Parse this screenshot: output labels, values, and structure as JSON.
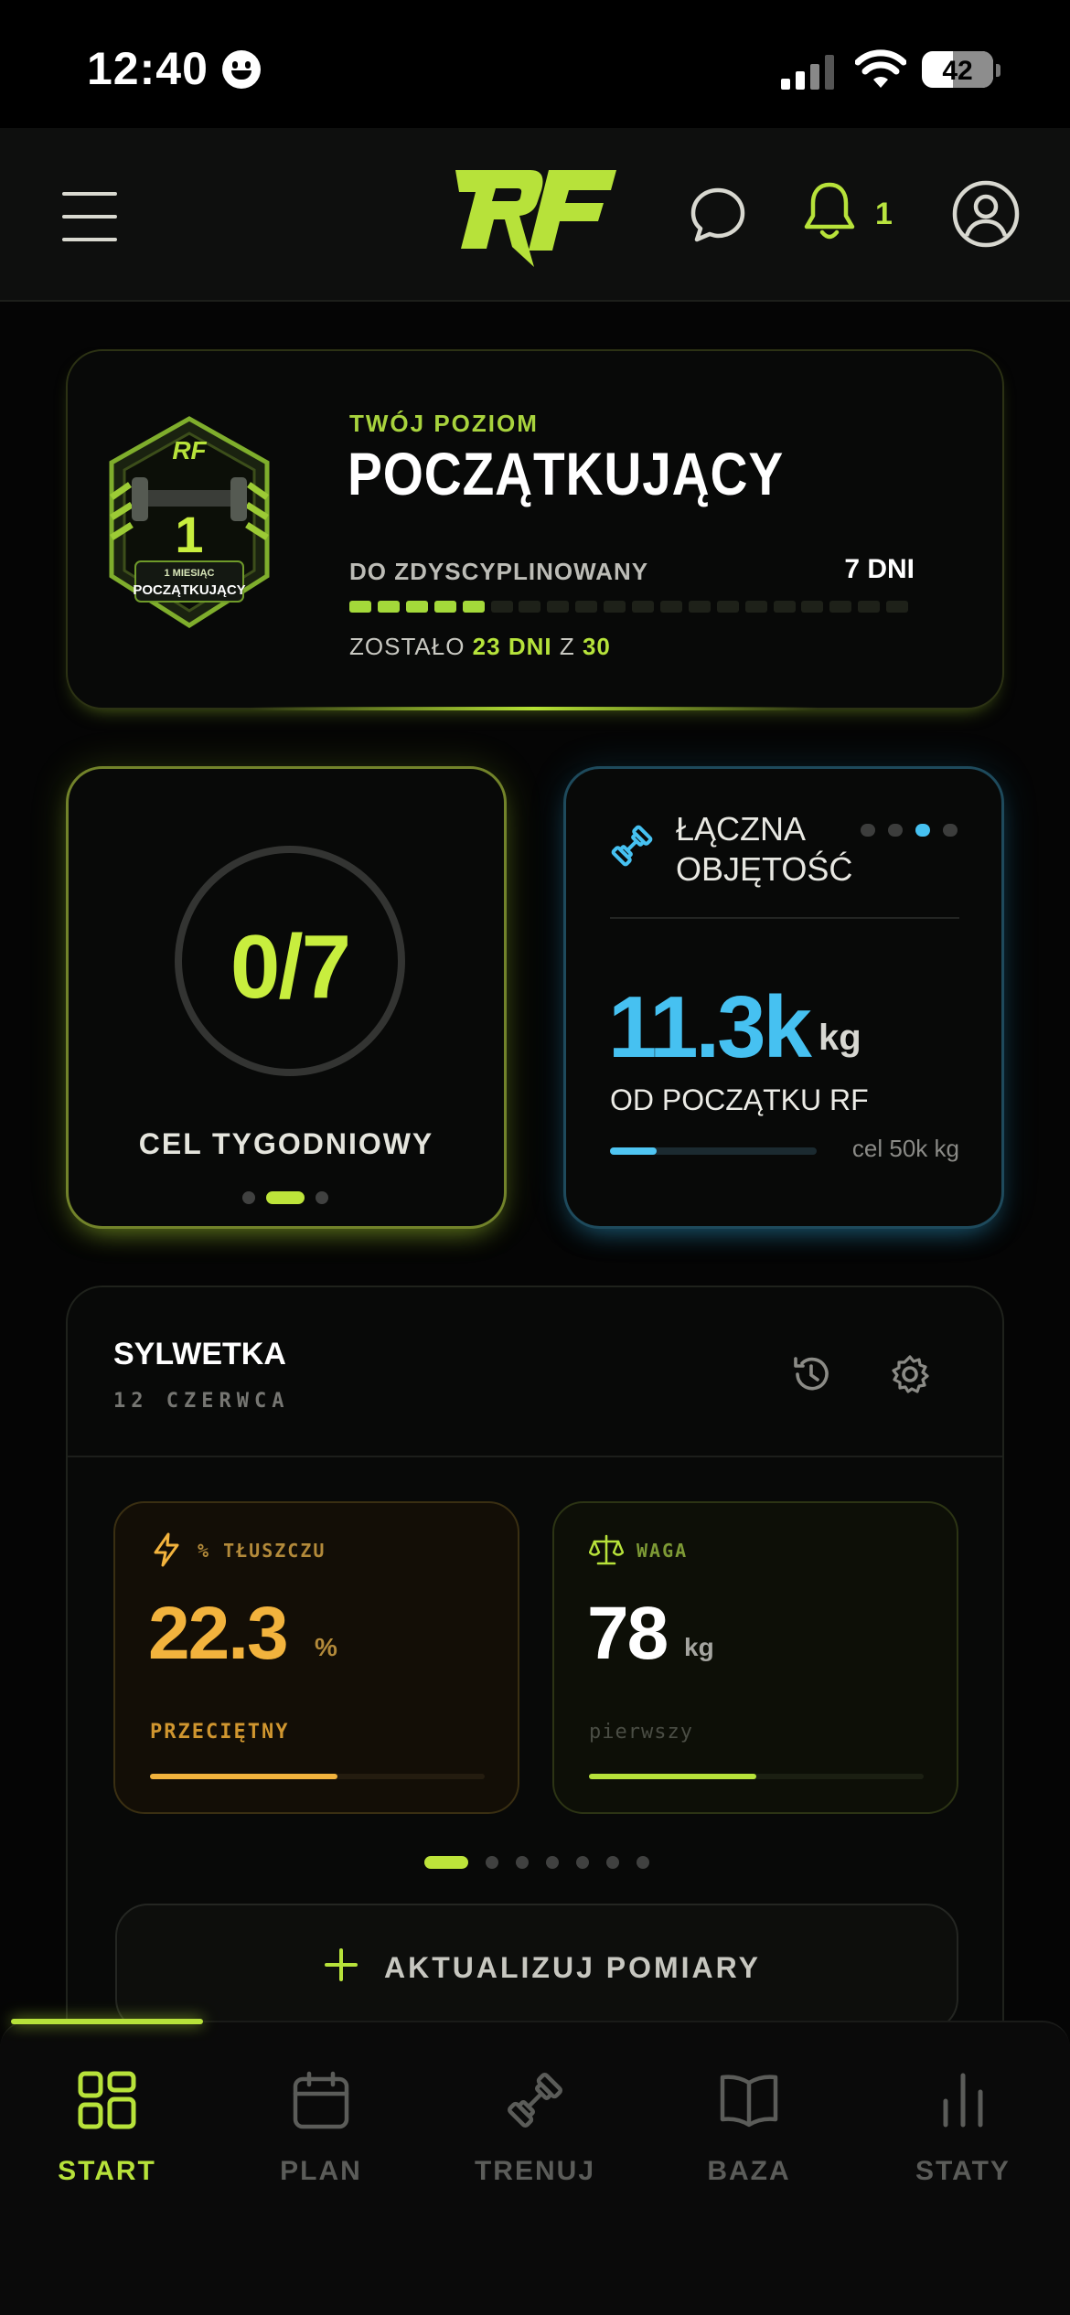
{
  "status_bar": {
    "time": "12:40",
    "battery": "42"
  },
  "header": {
    "logo": "RF",
    "notification_count": "1"
  },
  "level": {
    "eyebrow": "TWÓJ POZIOM",
    "title": "POCZĄTKUJĄCY",
    "next_label": "DO ZDYSCYPLINOWANY",
    "days_to_next": "7 DNI",
    "progress": {
      "filled": 5,
      "total": 20
    },
    "remaining_prefix": "ZOSTAŁO",
    "remaining_days": "23 DNI",
    "remaining_of": "Z",
    "remaining_total": "30",
    "badge": {
      "logo": "RF",
      "number": "1",
      "line1": "1 MIESIĄC",
      "line2": "POCZĄTKUJĄCY"
    }
  },
  "weekly_goal": {
    "value": "0/7",
    "label": "CEL TYGODNIOWY",
    "pager": {
      "count": 3,
      "active": 1
    }
  },
  "volume": {
    "title": "ŁĄCZNA OBJĘTOŚĆ",
    "value": "11.3k",
    "unit": "kg",
    "since": "OD POCZĄTKU RF",
    "goal": "cel 50k kg",
    "progress": 0.226,
    "pager": {
      "count": 4,
      "active": 2
    }
  },
  "silhouette": {
    "title": "SYLWETKA",
    "date": "12 CZERWCA",
    "metrics": [
      {
        "label": "% TŁUSZCZU",
        "value": "22.3",
        "unit": "%",
        "status": "PRZECIĘTNY",
        "progress": 0.56,
        "color": "#f2b33d"
      },
      {
        "label": "WAGA",
        "value": "78",
        "unit": "kg",
        "status": "pierwszy",
        "progress": 0.5,
        "color": "#b7e23a"
      }
    ],
    "pager": {
      "count": 7,
      "active": 0
    },
    "update_label": "AKTUALIZUJ POMIARY"
  },
  "tabs": [
    {
      "label": "START",
      "icon": "grid-icon",
      "active": true
    },
    {
      "label": "PLAN",
      "icon": "calendar-icon",
      "active": false
    },
    {
      "label": "TRENUJ",
      "icon": "dumbbell-icon",
      "active": false
    },
    {
      "label": "BAZA",
      "icon": "book-icon",
      "active": false
    },
    {
      "label": "STATY",
      "icon": "bar-chart-icon",
      "active": false
    }
  ],
  "colors": {
    "accent": "#b7e23a",
    "blue": "#46c1f1",
    "orange": "#f2b33d",
    "background": "#050505"
  }
}
